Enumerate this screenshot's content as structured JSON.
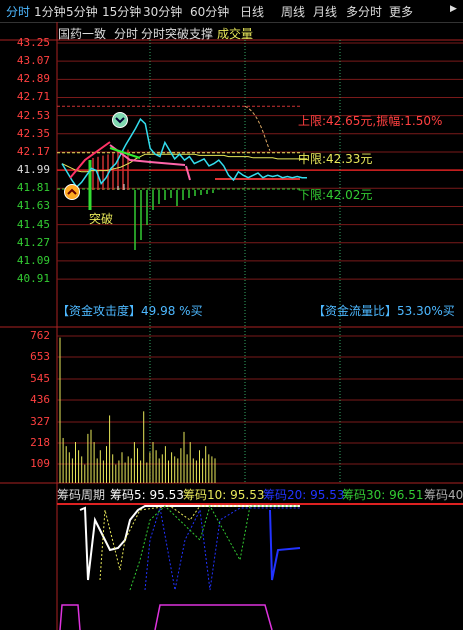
{
  "tabs": [
    "分时",
    "1分钟",
    "5分钟",
    "15分钟",
    "30分钟",
    "60分钟",
    "日线",
    "周线",
    "月线",
    "多分时",
    "更多"
  ],
  "active_tab": 0,
  "subtitle": {
    "stock": "国药一致",
    "mode": "分时",
    "indicator": "分时突破支撑",
    "volume_label": "成交量"
  },
  "price_axis": [
    "43.25",
    "43.07",
    "42.89",
    "42.71",
    "42.53",
    "42.35",
    "42.17",
    "41.99",
    "41.81",
    "41.63",
    "41.45",
    "41.27",
    "41.09",
    "40.91"
  ],
  "volume_axis": [
    "762",
    "653",
    "545",
    "436",
    "327",
    "218",
    "109"
  ],
  "annotations": {
    "upper": "上限:42.65元,振幅:1.50%",
    "middle": "中限:42.33元",
    "lower": "下限:42.02元",
    "breakout": "突破",
    "breakout_badge": "突破",
    "fund_attack": "【资金攻击度】49.98 %买",
    "fund_flow": "【资金流量比】53.30%买"
  },
  "chip_bar": {
    "title": "筹码周期",
    "c5": "筹码5: 95.53",
    "c10": "筹码10: 95.53",
    "c20": "筹码20: 95.53",
    "c30": "筹码30: 96.51",
    "c40": "筹码40"
  },
  "colors": {
    "up": "#ff3333",
    "down": "#33cc33",
    "price_line": "#33ddee",
    "avg_line": "#e8e85a",
    "accent_tab": "#4db8ff",
    "magenta": "#dd33dd",
    "blue": "#2233ff"
  },
  "chart_data": {
    "type": "line",
    "price": {
      "x": [
        0,
        1,
        2,
        3,
        4,
        5,
        6,
        7,
        8,
        9,
        10,
        11,
        12,
        13,
        14,
        15,
        16,
        17,
        18,
        19,
        20,
        21,
        22,
        23,
        24,
        25,
        26,
        27,
        28,
        29,
        30,
        31,
        32,
        33,
        34,
        35,
        36,
        37,
        38,
        39,
        40,
        41,
        42,
        43,
        44,
        45,
        46,
        47,
        48,
        49,
        50
      ],
      "values": [
        42.22,
        42.15,
        42.08,
        42.02,
        42.06,
        42.12,
        42.18,
        42.16,
        42.05,
        42.1,
        42.18,
        42.22,
        42.3,
        42.38,
        42.45,
        42.52,
        42.6,
        42.56,
        42.35,
        42.3,
        42.28,
        42.4,
        42.33,
        42.26,
        42.3,
        42.25,
        42.28,
        42.22,
        42.24,
        42.26,
        42.2,
        42.22,
        42.25,
        42.2,
        42.12,
        42.08,
        42.15,
        42.12,
        42.1,
        42.12,
        42.14,
        42.1,
        42.12,
        42.11,
        42.12,
        42.1,
        42.11,
        42.1,
        42.11,
        42.1,
        42.1
      ]
    },
    "avg": {
      "values": [
        42.22,
        42.2,
        42.18,
        42.16,
        42.15,
        42.15,
        42.16,
        42.16,
        42.16,
        42.16,
        42.17,
        42.18,
        42.19,
        42.21,
        42.23,
        42.26,
        42.28,
        42.3,
        42.3,
        42.3,
        42.3,
        42.3,
        42.3,
        42.3,
        42.3,
        42.3,
        42.3,
        42.3,
        42.29,
        42.29,
        42.29,
        42.29,
        42.29,
        42.29,
        42.28,
        42.28,
        42.28,
        42.28,
        42.28,
        42.27,
        42.27,
        42.27,
        42.27,
        42.27,
        42.26,
        42.26,
        42.26,
        42.26,
        42.26,
        42.26,
        42.26
      ]
    },
    "volume": [
      710,
      220,
      180,
      150,
      120,
      200,
      160,
      130,
      90,
      240,
      260,
      200,
      120,
      160,
      110,
      180,
      330,
      140,
      90,
      110,
      150,
      100,
      130,
      120,
      200,
      170,
      110,
      350,
      100,
      150,
      200,
      160,
      120,
      140,
      180,
      110,
      150,
      130,
      120,
      170,
      250,
      140,
      200,
      120,
      110,
      160,
      120,
      180,
      140,
      130,
      120
    ],
    "y_range": [
      40.91,
      43.25
    ],
    "volume_range": [
      0,
      762
    ]
  }
}
